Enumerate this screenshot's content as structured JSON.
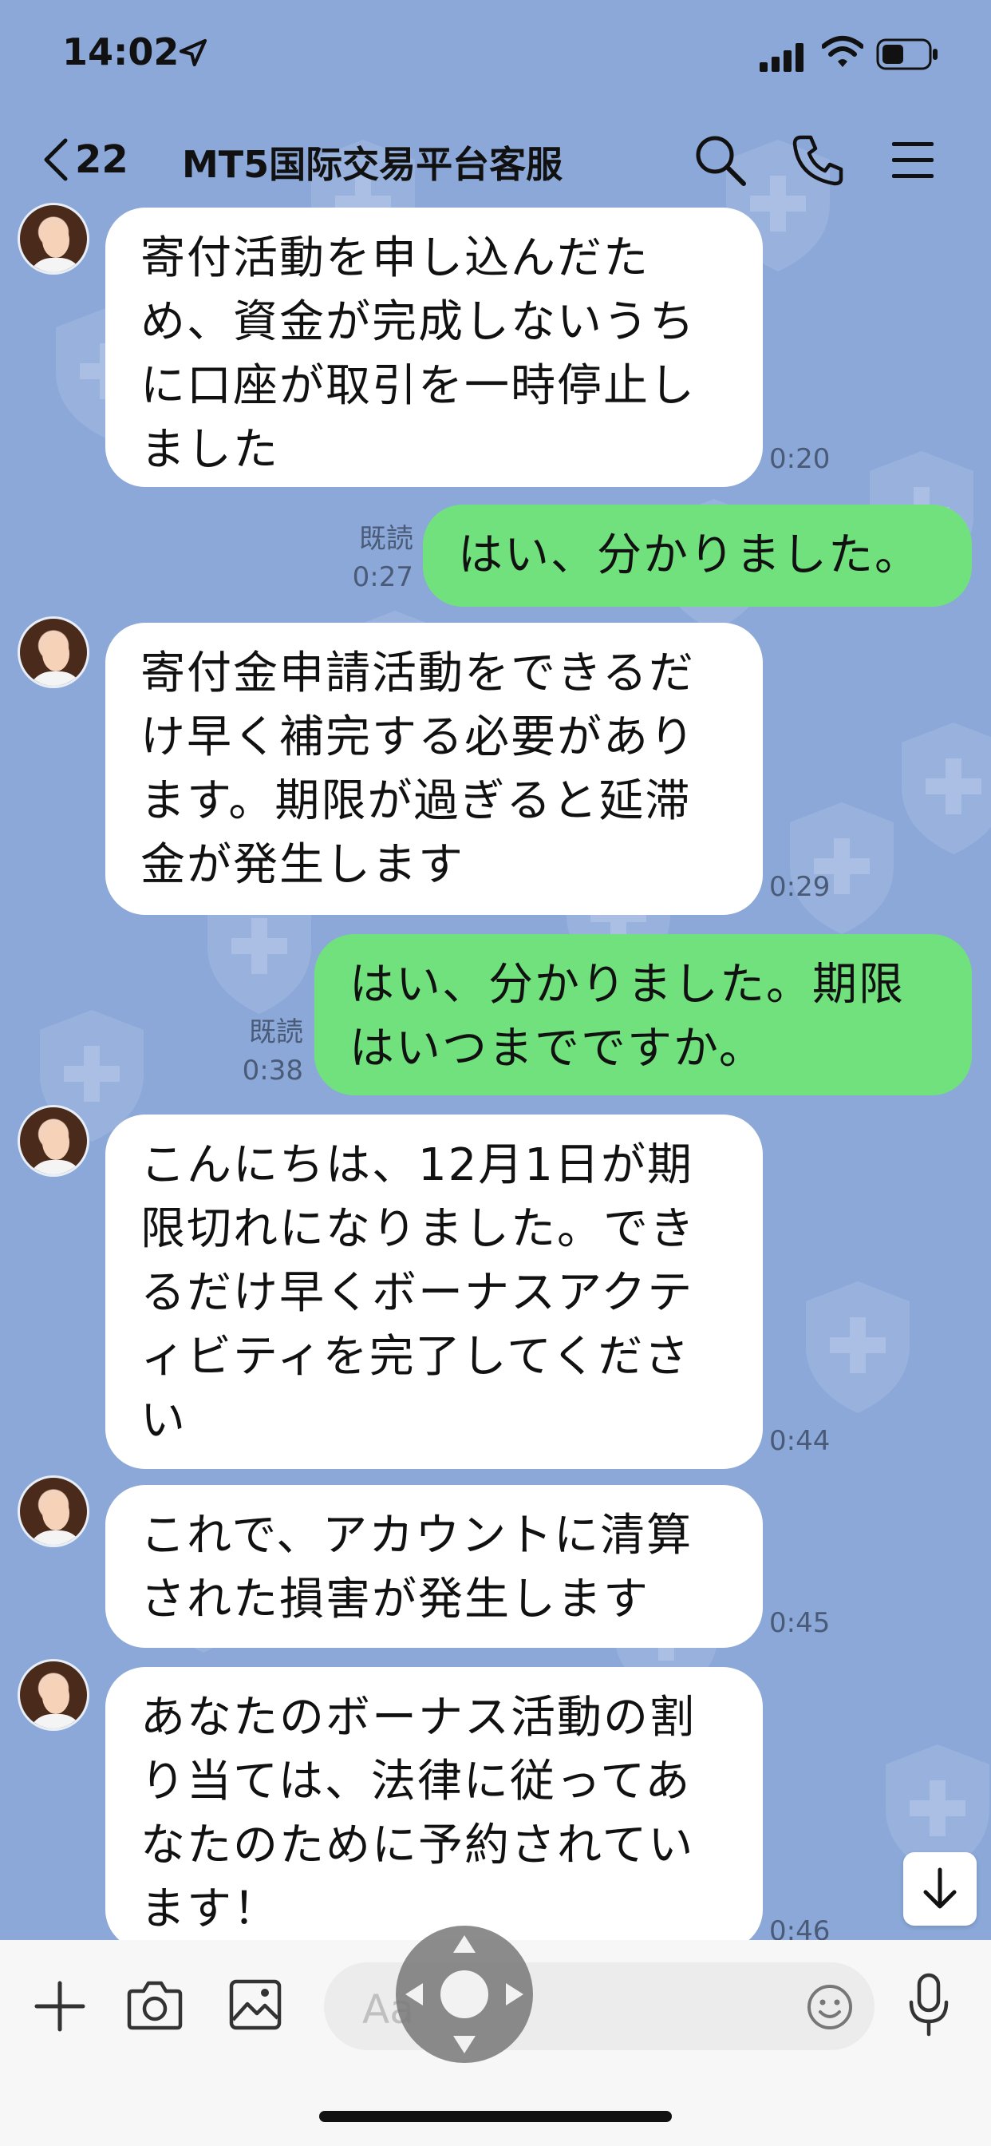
{
  "status_bar": {
    "time": "14:02"
  },
  "header": {
    "back_count": "22",
    "title": "MT5国际交易平台客服"
  },
  "messages": [
    {
      "side": "them",
      "text": "寄付活動を申し込んだため、資金が完成しないうちに口座が取引を一時停止しました",
      "time": "0:20"
    },
    {
      "side": "me",
      "text": "はい、分かりました。",
      "read": "既読",
      "time": "0:27"
    },
    {
      "side": "them",
      "text": "寄付金申請活動をできるだけ早く補完する必要があります。期限が過ぎると延滞金が発生します",
      "time": "0:29"
    },
    {
      "side": "me",
      "text": "はい、分かりました。期限はいつまでですか。",
      "read": "既読",
      "time": "0:38"
    },
    {
      "side": "them",
      "text": "こんにちは、12月1日が期限切れになりました。できるだけ早くボーナスアクティビティを完了してください",
      "time": "0:44"
    },
    {
      "side": "them",
      "text": "これで、アカウントに清算された損害が発生します",
      "time": "0:45"
    },
    {
      "side": "them",
      "text": "あなたのボーナス活動の割り当ては、法律に従ってあなたのために予約されています！",
      "time": "0:46"
    }
  ],
  "input": {
    "placeholder": "Aa"
  },
  "colors": {
    "background": "#8ba8d8",
    "my_bubble": "#71e17d",
    "their_bubble": "#ffffff"
  }
}
